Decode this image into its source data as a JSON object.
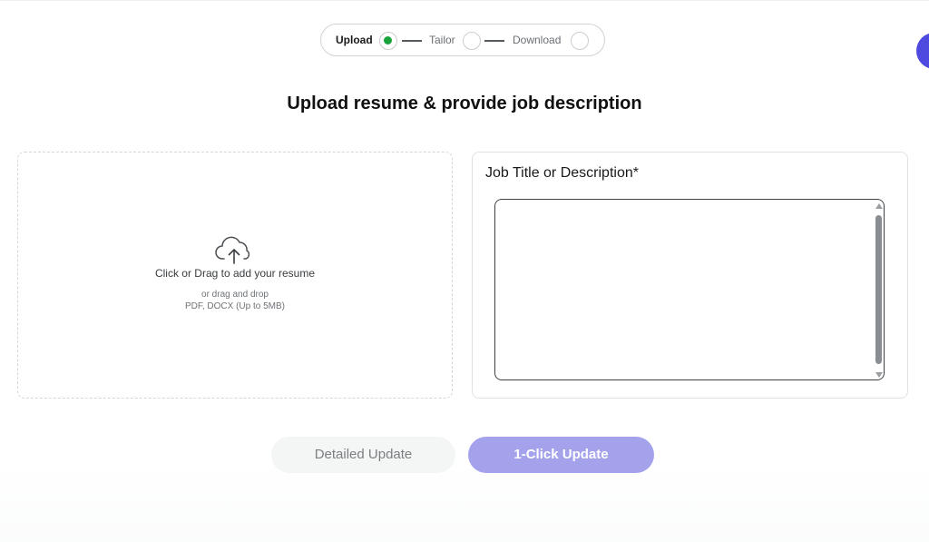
{
  "stepper": {
    "steps": [
      {
        "label": "Upload",
        "state": "done"
      },
      {
        "label": "Tailor",
        "state": "pending"
      },
      {
        "label": "Download",
        "state": "pending"
      }
    ]
  },
  "heading": "Upload resume & provide job description",
  "upload": {
    "icon": "cloud-upload-icon",
    "main_text": "Click or Drag to add your resume",
    "sub_text": "or drag and drop",
    "formats_text": "PDF, DOCX (Up to 5MB)"
  },
  "job": {
    "label": "Job Title or Description*",
    "value": "",
    "placeholder": ""
  },
  "buttons": {
    "detailed": "Detailed Update",
    "one_click": "1-Click Update"
  },
  "colors": {
    "accent": "#a5a2ec",
    "step_done": "#1aa33a",
    "side_button": "#4e4ae0"
  }
}
